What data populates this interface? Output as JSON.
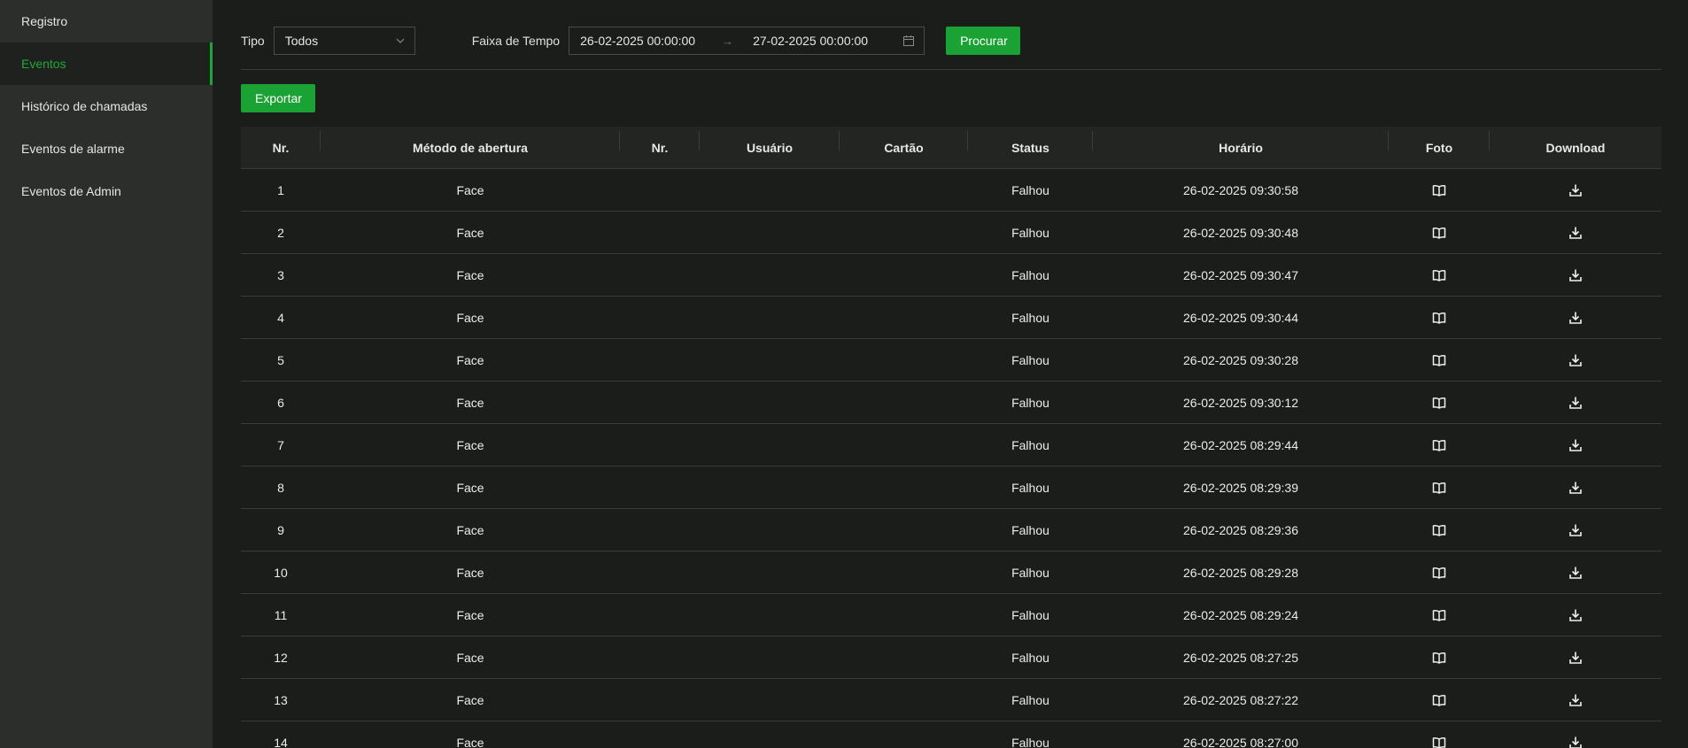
{
  "sidebar": {
    "items": [
      {
        "label": "Registro"
      },
      {
        "label": "Eventos"
      },
      {
        "label": "Histórico de chamadas"
      },
      {
        "label": "Eventos de alarme"
      },
      {
        "label": "Eventos de Admin"
      }
    ]
  },
  "filters": {
    "type_label": "Tipo",
    "type_value": "Todos",
    "range_label": "Faixa de Tempo",
    "range_start": "26-02-2025 00:00:00",
    "range_end": "27-02-2025 00:00:00",
    "range_arrow": "→",
    "search_label": "Procurar"
  },
  "export_label": "Exportar",
  "table": {
    "headers": [
      "Nr.",
      "Método de abertura",
      "Nr.",
      "Usuário",
      "Cartão",
      "Status",
      "Horário",
      "Foto",
      "Download"
    ],
    "rows": [
      {
        "nr": "1",
        "method": "Face",
        "nr2": "",
        "user": "",
        "card": "",
        "status": "Falhou",
        "time": "26-02-2025 09:30:58"
      },
      {
        "nr": "2",
        "method": "Face",
        "nr2": "",
        "user": "",
        "card": "",
        "status": "Falhou",
        "time": "26-02-2025 09:30:48"
      },
      {
        "nr": "3",
        "method": "Face",
        "nr2": "",
        "user": "",
        "card": "",
        "status": "Falhou",
        "time": "26-02-2025 09:30:47"
      },
      {
        "nr": "4",
        "method": "Face",
        "nr2": "",
        "user": "",
        "card": "",
        "status": "Falhou",
        "time": "26-02-2025 09:30:44"
      },
      {
        "nr": "5",
        "method": "Face",
        "nr2": "",
        "user": "",
        "card": "",
        "status": "Falhou",
        "time": "26-02-2025 09:30:28"
      },
      {
        "nr": "6",
        "method": "Face",
        "nr2": "",
        "user": "",
        "card": "",
        "status": "Falhou",
        "time": "26-02-2025 09:30:12"
      },
      {
        "nr": "7",
        "method": "Face",
        "nr2": "",
        "user": "",
        "card": "",
        "status": "Falhou",
        "time": "26-02-2025 08:29:44"
      },
      {
        "nr": "8",
        "method": "Face",
        "nr2": "",
        "user": "",
        "card": "",
        "status": "Falhou",
        "time": "26-02-2025 08:29:39"
      },
      {
        "nr": "9",
        "method": "Face",
        "nr2": "",
        "user": "",
        "card": "",
        "status": "Falhou",
        "time": "26-02-2025 08:29:36"
      },
      {
        "nr": "10",
        "method": "Face",
        "nr2": "",
        "user": "",
        "card": "",
        "status": "Falhou",
        "time": "26-02-2025 08:29:28"
      },
      {
        "nr": "11",
        "method": "Face",
        "nr2": "",
        "user": "",
        "card": "",
        "status": "Falhou",
        "time": "26-02-2025 08:29:24"
      },
      {
        "nr": "12",
        "method": "Face",
        "nr2": "",
        "user": "",
        "card": "",
        "status": "Falhou",
        "time": "26-02-2025 08:27:25"
      },
      {
        "nr": "13",
        "method": "Face",
        "nr2": "",
        "user": "",
        "card": "",
        "status": "Falhou",
        "time": "26-02-2025 08:27:22"
      },
      {
        "nr": "14",
        "method": "Face",
        "nr2": "",
        "user": "",
        "card": "",
        "status": "Falhou",
        "time": "26-02-2025 08:27:00"
      }
    ]
  },
  "icons": {
    "photo": "book-open-icon",
    "download": "download-icon",
    "type_dropdown": "chevron-down-icon",
    "calendar": "calendar-icon"
  },
  "colors": {
    "accent": "#1aa334",
    "sidebar_bg": "#2c2e2b",
    "main_bg": "#1b1d1a",
    "header_bg": "#232522"
  }
}
